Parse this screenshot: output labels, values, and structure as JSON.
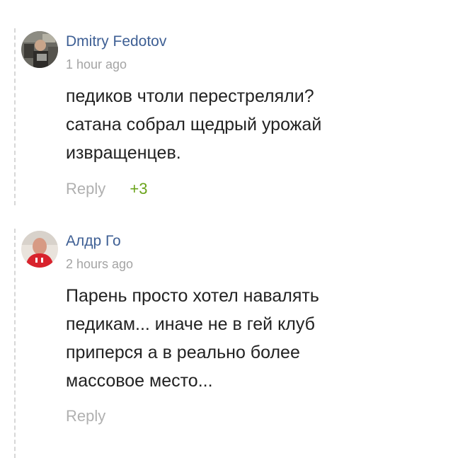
{
  "comments": [
    {
      "author": "Dmitry Fedotov",
      "time": "1 hour ago",
      "text_lines": [
        "педиков чтоли перестреляли?",
        "сатана собрал щедрый урожай",
        "извращенцев."
      ],
      "reply_label": "Reply",
      "votes": "+3"
    },
    {
      "author": "Алдр Го",
      "time": "2 hours ago",
      "text_lines": [
        "Парень просто хотел навалять",
        "педикам... иначе не в гей клуб",
        "приперся а в реально более",
        "массовое место..."
      ],
      "reply_label": "Reply"
    }
  ],
  "colors": {
    "author": "#3e5f94",
    "meta": "#a4a4a4",
    "votes_positive": "#6aa31a",
    "thread_line": "#d7d7d7"
  }
}
